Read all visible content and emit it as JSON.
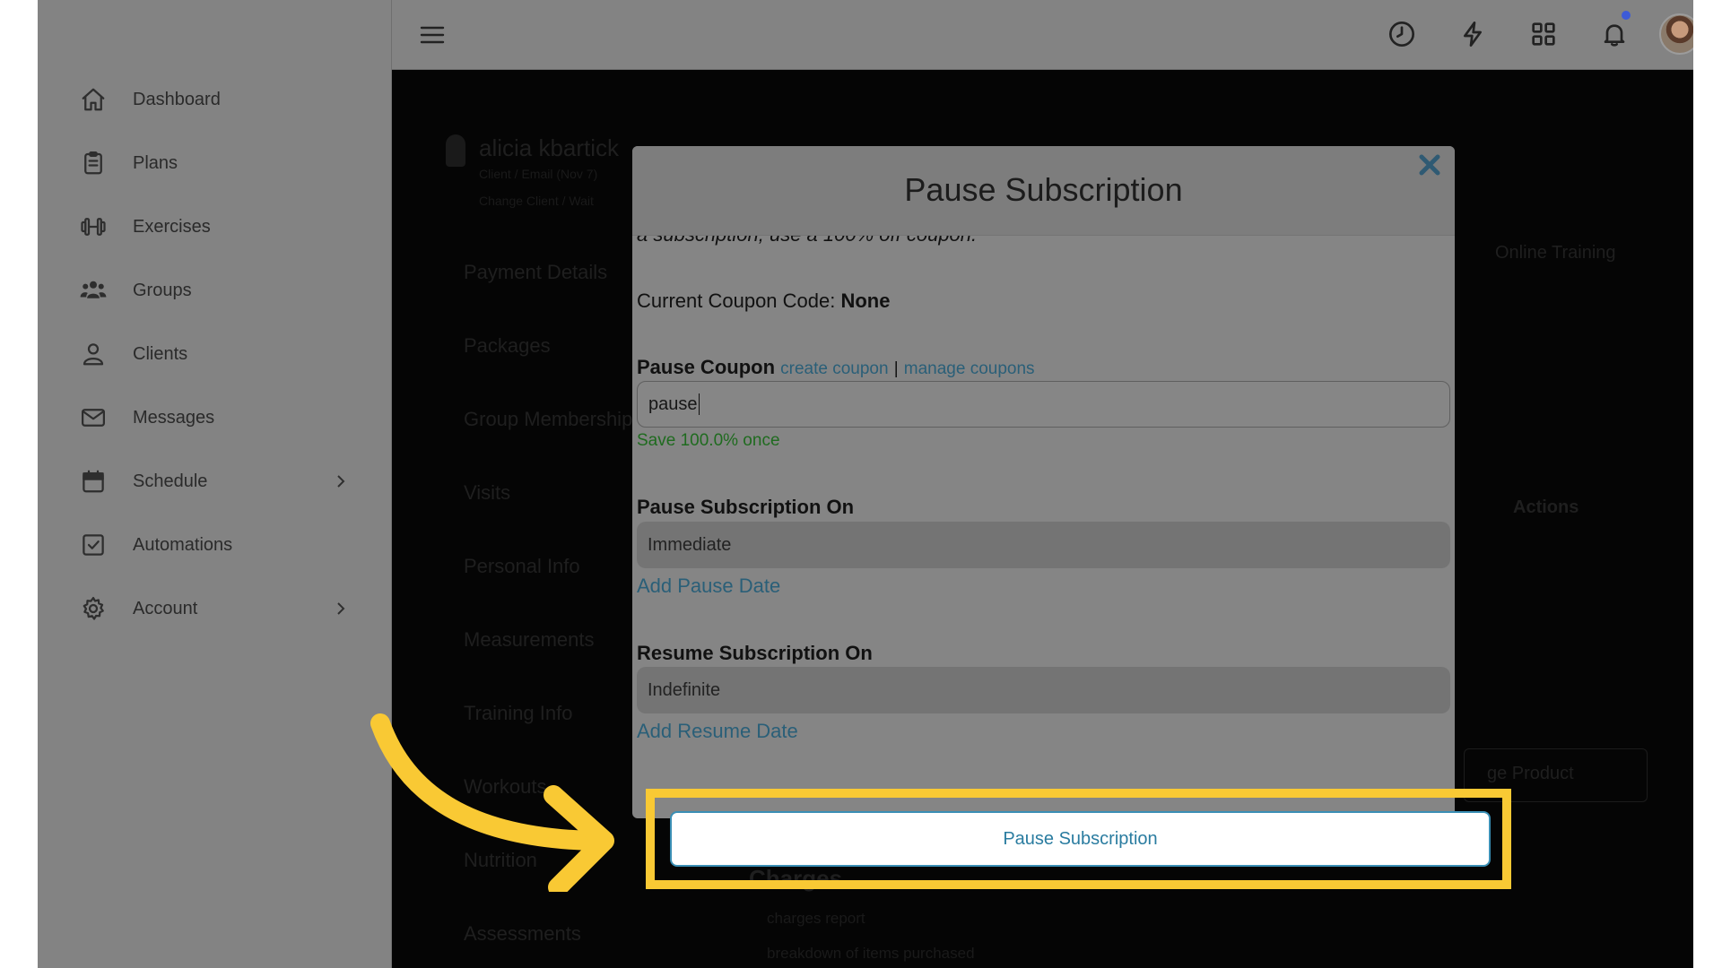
{
  "sidebar": {
    "items": [
      {
        "label": "Dashboard",
        "icon": "home-icon"
      },
      {
        "label": "Plans",
        "icon": "clipboard-icon"
      },
      {
        "label": "Exercises",
        "icon": "dumbbell-icon"
      },
      {
        "label": "Groups",
        "icon": "users-icon"
      },
      {
        "label": "Clients",
        "icon": "user-icon"
      },
      {
        "label": "Messages",
        "icon": "envelope-icon"
      },
      {
        "label": "Schedule",
        "icon": "calendar-icon",
        "has_submenu": true
      },
      {
        "label": "Automations",
        "icon": "checkbox-icon"
      },
      {
        "label": "Account",
        "icon": "gear-icon",
        "has_submenu": true
      }
    ]
  },
  "topbar": {
    "icons": [
      "menu-icon",
      "clock-icon",
      "lightning-icon",
      "grid-icon",
      "bell-icon",
      "avatar"
    ],
    "notification_dot_color": "#3d5bd8"
  },
  "background_page": {
    "client_name": "alicia kbartick",
    "client_sub": "Client / Email (Nov 7)",
    "client_sub2": "Change Client / Wait",
    "tabs": [
      "Payment Details",
      "Packages",
      "Group Memberships",
      "Visits",
      "Personal Info",
      "Measurements",
      "Training Info",
      "Workouts",
      "Nutrition",
      "Assessments"
    ],
    "right_label": "Online Training",
    "actions_label": "Actions",
    "change_product_label": "ge Product",
    "charges_label": "Charges",
    "charges_report": "charges report",
    "charges_breakdown": "breakdown of items purchased"
  },
  "modal": {
    "title": "Pause Subscription",
    "intro_fragment": "a subscription, use a 100% off coupon.",
    "current_coupon_label": "Current Coupon Code:",
    "current_coupon_value": "None",
    "pause_coupon_label": "Pause Coupon",
    "create_coupon_link": "create coupon",
    "link_separator": "|",
    "manage_coupons_link": "manage coupons",
    "coupon_input_value": "pause",
    "coupon_savings": "Save 100.0% once",
    "pause_on_label": "Pause Subscription On",
    "pause_on_value": "Immediate",
    "add_pause_date_link": "Add Pause Date",
    "resume_on_label": "Resume Subscription On",
    "resume_on_value": "Indefinite",
    "add_resume_date_link": "Add Resume Date",
    "submit_button_label": "Pause Subscription"
  },
  "colors": {
    "highlight": "#f9c934",
    "link": "#2a5f78",
    "success_text": "#1f6b1f",
    "button_text": "#2a7ca0"
  }
}
